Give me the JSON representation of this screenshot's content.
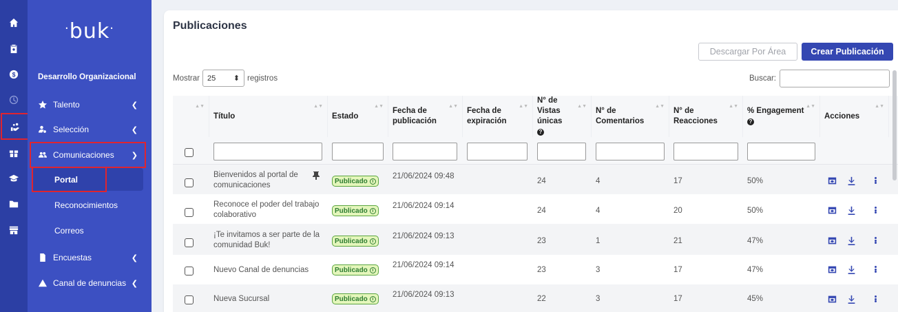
{
  "rail": {
    "icons": [
      "home-icon",
      "clipboard-icon",
      "dollar-icon",
      "clock-icon",
      "hand-people-icon",
      "gift-icon",
      "graduation-cap-icon",
      "folder-icon",
      "store-icon"
    ]
  },
  "sidebar": {
    "logo": "buk",
    "section_title": "Desarrollo Organizacional",
    "items": [
      {
        "label": "Talento",
        "icon": "star-icon"
      },
      {
        "label": "Selección",
        "icon": "user-search-icon"
      },
      {
        "label": "Comunicaciones",
        "icon": "users-icon"
      },
      {
        "label": "Encuestas",
        "icon": "document-icon"
      },
      {
        "label": "Canal de denuncias",
        "icon": "warning-icon"
      }
    ],
    "subitems": [
      "Portal",
      "Reconocimientos",
      "Correos"
    ]
  },
  "main": {
    "title": "Publicaciones",
    "btn_download": "Descargar Por Área",
    "btn_create": "Crear Publicación",
    "show_label": "Mostrar",
    "page_length": "25",
    "records_label": "registros",
    "search_label": "Buscar:"
  },
  "table": {
    "headers": [
      "Título",
      "Estado",
      "Fecha de publicación",
      "Fecha de expiración",
      "N° de Vistas únicas",
      "N° de Comentarios",
      "N° de Reacciones",
      "% Engagement",
      "Acciones"
    ],
    "rows": [
      {
        "title": "Bienvenidos al portal de comunicaciones",
        "status": "Publicado",
        "published": "21/06/2024 09:48",
        "views": "24",
        "comments": "4",
        "reactions": "17",
        "engagement": "50%"
      },
      {
        "title": "Reconoce el poder del trabajo colaborativo",
        "status": "Publicado",
        "published": "21/06/2024 09:14",
        "views": "24",
        "comments": "4",
        "reactions": "20",
        "engagement": "50%"
      },
      {
        "title": "¡Te invitamos a ser parte de la comunidad Buk!",
        "status": "Publicado",
        "published": "21/06/2024 09:13",
        "views": "23",
        "comments": "1",
        "reactions": "21",
        "engagement": "47%"
      },
      {
        "title": "Nuevo Canal de denuncias",
        "status": "Publicado",
        "published": "21/06/2024 09:14",
        "views": "23",
        "comments": "3",
        "reactions": "17",
        "engagement": "47%"
      },
      {
        "title": "Nueva Sucursal",
        "status": "Publicado",
        "published": "21/06/2024 09:13",
        "views": "22",
        "comments": "3",
        "reactions": "17",
        "engagement": "45%"
      }
    ]
  }
}
